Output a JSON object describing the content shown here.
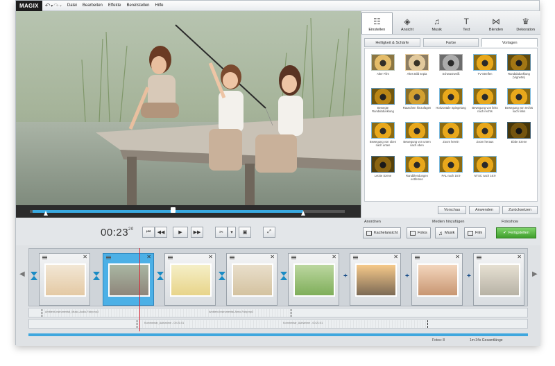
{
  "app": {
    "logo": "MAGIX"
  },
  "menu": {
    "items": [
      "Datei",
      "Bearbeiten",
      "Effekte",
      "Bereitstellen",
      "Hilfe"
    ]
  },
  "effect_tabs": [
    {
      "label": "Einstellen",
      "icon": "sliders-icon",
      "glyph": "☷",
      "active": true
    },
    {
      "label": "Ansicht",
      "icon": "camera-icon",
      "glyph": "◈",
      "active": false
    },
    {
      "label": "Musik",
      "icon": "music-icon",
      "glyph": "♫",
      "active": false
    },
    {
      "label": "Text",
      "icon": "text-icon",
      "glyph": "T",
      "active": false
    },
    {
      "label": "Blenden",
      "icon": "transition-icon",
      "glyph": "⋈",
      "active": false
    },
    {
      "label": "Dekoration",
      "icon": "decoration-icon",
      "glyph": "♛",
      "active": false
    }
  ],
  "sub_tabs": [
    {
      "label": "Helligkeit & Schärfe",
      "active": false
    },
    {
      "label": "Farbe",
      "active": false
    },
    {
      "label": "Vorlagen",
      "active": true
    }
  ],
  "presets": [
    "Alter Film",
    "Altes Bild sepia",
    "Schwarzweiß",
    "TV-Streifen",
    "Randabdunklung (Vignette)",
    "Bewegte Randabdunklung",
    "Rauschen hinzufügen",
    "Horizontale Spiegelung",
    "Bewegung von links nach rechts",
    "Bewegung von rechts nach links",
    "Bewegung von oben nach unten",
    "Bewegung von unten nach oben",
    "Zoom herein",
    "Zoom heraus",
    "Ebbe Szene",
    "Letzte Szene",
    "Randblendungen entfernen",
    "PAL nach 16:9",
    "NTSC nach 16:9"
  ],
  "panel_buttons": {
    "preview": "Vorschau",
    "apply": "Anwenden",
    "reset": "Zurücksetzen"
  },
  "transport": {
    "time": "00:23",
    "frames": "20"
  },
  "groups": {
    "arrange": {
      "label": "Anordnen",
      "button": "Kachelansicht"
    },
    "add_media": {
      "label": "Medien hinzufügen",
      "photos": "Fotos",
      "music": "Musik",
      "film": "Film"
    },
    "slideshow": {
      "label": "Fotoshow",
      "finish": "Fertigstellen"
    }
  },
  "audio_tracks": [
    {
      "text_a": "Ambient-Instrumental_Music-Audio-Fairy.mp3",
      "text_b": "Ambient-Instrumental-Atmo-Fairy.mp3"
    },
    {
      "text_a": "Kommentar_Aufnahme - 00:21:01",
      "text_b": "Kommentar_Aufnahme - 00:21:01"
    }
  ],
  "status": {
    "photos": "Fotos: 8",
    "duration": "1m:34s Gesamtlänge"
  },
  "colors": {
    "accent": "#3fa7de",
    "finish": "#4caf35"
  }
}
